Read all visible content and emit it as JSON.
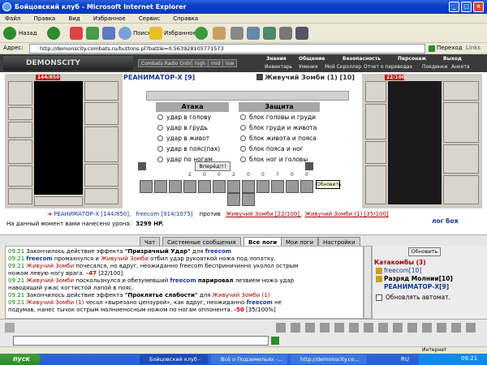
{
  "window": {
    "title": "Бойцовский клуб - Microsoft Internet Explorer"
  },
  "menu": [
    "Файл",
    "Правка",
    "Вид",
    "Избранное",
    "Сервис",
    "Справка"
  ],
  "toolbar": {
    "back": "Назад",
    "search": "Поиск",
    "favorites": "Избранное"
  },
  "address": {
    "label": "Адрес:",
    "url": "http://demonscity.combats.ru/buttons.pl?battle=0.563928105771573",
    "go": "Переход",
    "links": "Links"
  },
  "game": {
    "logo": "DEMONSCITY",
    "radio": [
      "Combats Radio Online",
      "high",
      "mid",
      "low"
    ],
    "nav": [
      "Знания",
      "Общение",
      "Безопасность",
      "Персонаж",
      "Выход"
    ],
    "subnav": [
      "Инвентарь",
      "Умения",
      "Мой Скроллер",
      "Отчет о переводах",
      "Поединки",
      "Анкета"
    ]
  },
  "battle": {
    "player": {
      "name": "РЕАНИМАТОР-Х [9]",
      "hp": "144/850"
    },
    "enemy": {
      "name": "Живучий Зомби (1) [10]",
      "hp": "22/100"
    },
    "attack_title": "Атака",
    "defense_title": "Защита",
    "attacks": [
      "удар в голову",
      "удар в грудь",
      "удар в живот",
      "удар в пояс(пах)",
      "удар по ногам"
    ],
    "defenses": [
      "блок головы и груди",
      "блок груди и живота",
      "блок живота и пояса",
      "блок пояса и ног",
      "блок ног и головы"
    ],
    "forward": "Вперёд!!!",
    "stats": [
      "2",
      "0",
      "0",
      "2",
      "0",
      "0",
      "7",
      "0",
      "0"
    ],
    "tooltip": "Обновить",
    "vs_prefix": "РЕАНИМАТОР-Х [144/850],",
    "vs_ally": "freecom [914/1075]",
    "vs_word": "против",
    "vs_enemy1": "Живучий Зомби [22/100],",
    "vs_enemy2": "Живучий Зомби (1) [35/100]",
    "log_link": "лог боя",
    "damage_text": "На данный момент вами нанесено урона:",
    "damage_value": "3299 HP."
  },
  "tabs": [
    "Чат",
    "Системные сообщения",
    "Все логи",
    "Мои логи",
    "Настройки"
  ],
  "chat": [
    [
      "09:21",
      "Закончилось действие эффекта",
      "\"Призрачный Удар\"",
      "для",
      "freecom"
    ],
    [
      "09:21",
      "freecom",
      "промахнулся и",
      "Живучий Зомби",
      "отбил удар рукояткой ножа под лопатку."
    ],
    [
      "09:21",
      "Живучий Зомби",
      "почесался, но вдруг, неожиданно freecom бесприничинно уколол острым"
    ],
    [
      "ножом левую ногу врага.",
      "-47",
      "[22/100]"
    ],
    [
      "09:21",
      "Живучий Зомби",
      "поскользнулся и обезумевший",
      "freecom",
      "парировал",
      "лезвием ножа удар"
    ],
    [
      "наводящий ужас когтистой лапой в пояс."
    ],
    [
      "09:21",
      "Закончилось действие эффекта",
      "\"Проклятье слабости\"",
      "для",
      "Живучий Зомби (1)"
    ],
    [
      "09:21",
      "Живучий Зомби (1)",
      "чесал «вырезано цензурой», как вдруг, неожиданно",
      "freecom",
      "не"
    ],
    [
      "подумав, нанес тычок острым молниеносным ножом по ногам оппонента.",
      "-50",
      "[35/100%]"
    ]
  ],
  "side": {
    "refresh": "Обновить",
    "location": "Катакомбы (3)",
    "members": [
      "freecom[10]",
      "Разряд Молнии[10]",
      "РЕАНИМАТОР-Х[9]"
    ],
    "auto": "Обновлять автомат."
  },
  "statusbar": {
    "zone": "Интернет"
  },
  "taskbar": {
    "start": "пуск",
    "tasks": [
      "Бойцовский клуб - М...",
      "Всё о Подземельях -...",
      "http://demonscity.co..."
    ],
    "lang": "RU",
    "clock": "09:21"
  },
  "colors": {
    "titlebar": "#0a3fc6",
    "player_name": "#14388c",
    "hp": "#c40000",
    "timestamp": "#008000"
  }
}
